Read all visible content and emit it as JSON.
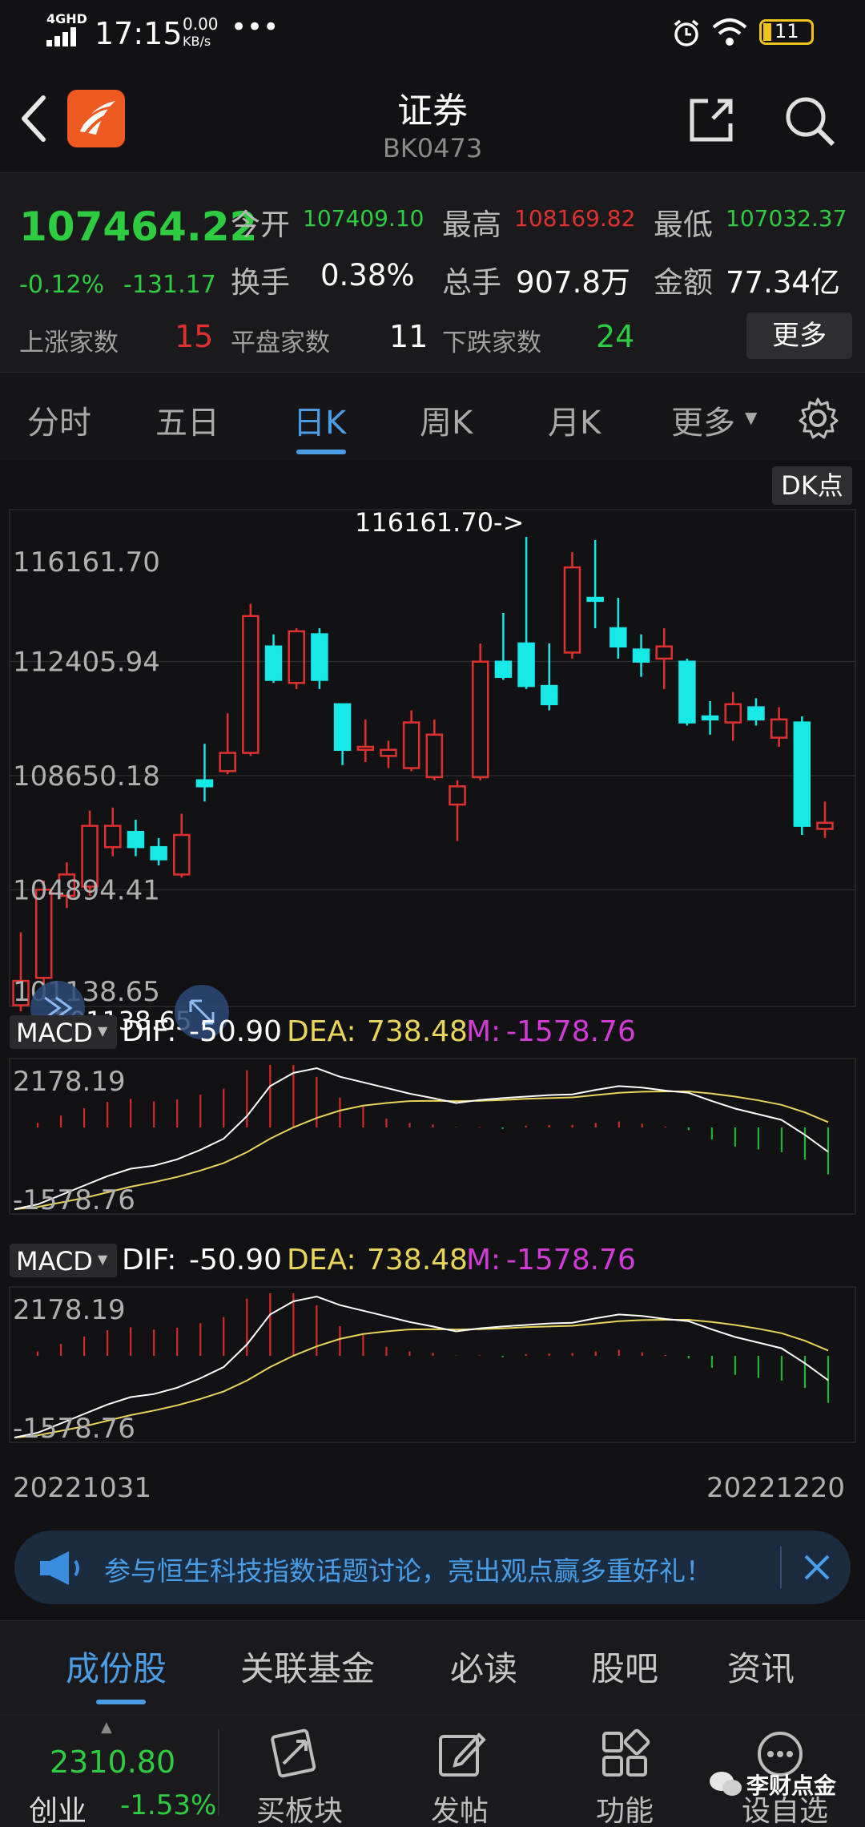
{
  "status_bar": {
    "network": "4GHD",
    "time": "17:15",
    "speed_value": "0.00",
    "speed_unit": "KB/s",
    "battery": "11"
  },
  "header": {
    "title": "证券",
    "code": "BK0473"
  },
  "quote": {
    "price": "107464.22",
    "change_pct": "-0.12%",
    "change_abs": "-131.17",
    "open_label": "今开",
    "open": "107409.10",
    "high_label": "最高",
    "high": "108169.82",
    "low_label": "最低",
    "low": "107032.37",
    "turnover_label": "换手",
    "turnover": "0.38%",
    "volume_label": "总手",
    "volume": "907.8万",
    "amount_label": "金额",
    "amount": "77.34亿",
    "up_label": "上涨家数",
    "up": "15",
    "flat_label": "平盘家数",
    "flat": "11",
    "down_label": "下跌家数",
    "down": "24",
    "more_button": "更多"
  },
  "tabs": [
    "分时",
    "五日",
    "日K",
    "周K",
    "月K",
    "更多"
  ],
  "active_tab": "日K",
  "chart_controls": {
    "dk_button": "DK点",
    "max_marker": "116161.70->",
    "min_marker": "<-101138.65"
  },
  "chart_data": {
    "type": "candlestick",
    "y_ticks": [
      "116161.70",
      "112405.94",
      "108650.18",
      "104894.41",
      "101138.65"
    ],
    "ylim": [
      101138.65,
      116161.7
    ],
    "x_start": "20221031",
    "x_end": "20221220",
    "colors": {
      "up": "#e0312f",
      "down": "#17e8e8"
    },
    "candles": [
      {
        "o": 101100,
        "c": 101900,
        "h": 103500,
        "l": 100900
      },
      {
        "o": 102000,
        "c": 104900,
        "h": 105200,
        "l": 101500
      },
      {
        "o": 104700,
        "c": 105400,
        "h": 105800,
        "l": 104300
      },
      {
        "o": 105000,
        "c": 107000,
        "h": 107500,
        "l": 104700
      },
      {
        "o": 106300,
        "c": 107000,
        "h": 107600,
        "l": 106000
      },
      {
        "o": 106800,
        "c": 106300,
        "h": 107200,
        "l": 106000
      },
      {
        "o": 106300,
        "c": 105900,
        "h": 106600,
        "l": 105700
      },
      {
        "o": 105400,
        "c": 106700,
        "h": 107400,
        "l": 105300
      },
      {
        "o": 108500,
        "c": 108300,
        "h": 109700,
        "l": 107800
      },
      {
        "o": 108800,
        "c": 109400,
        "h": 110700,
        "l": 108700
      },
      {
        "o": 109400,
        "c": 113900,
        "h": 114300,
        "l": 109300
      },
      {
        "o": 112900,
        "c": 111800,
        "h": 113300,
        "l": 111700
      },
      {
        "o": 111700,
        "c": 113400,
        "h": 113500,
        "l": 111500
      },
      {
        "o": 113300,
        "c": 111800,
        "h": 113500,
        "l": 111500
      },
      {
        "o": 111000,
        "c": 109500,
        "h": 111000,
        "l": 109000
      },
      {
        "o": 109500,
        "c": 109600,
        "h": 110500,
        "l": 109100
      },
      {
        "o": 109300,
        "c": 109500,
        "h": 109800,
        "l": 108900
      },
      {
        "o": 108900,
        "c": 110400,
        "h": 110800,
        "l": 108800
      },
      {
        "o": 108600,
        "c": 110000,
        "h": 110500,
        "l": 108500
      },
      {
        "o": 107700,
        "c": 108300,
        "h": 108500,
        "l": 106500
      },
      {
        "o": 108600,
        "c": 112400,
        "h": 113000,
        "l": 108500
      },
      {
        "o": 112400,
        "c": 111900,
        "h": 114000,
        "l": 111800
      },
      {
        "o": 113000,
        "c": 111600,
        "h": 116500,
        "l": 111500
      },
      {
        "o": 111600,
        "c": 111000,
        "h": 113000,
        "l": 110800
      },
      {
        "o": 112700,
        "c": 115500,
        "h": 116000,
        "l": 112500
      },
      {
        "o": 114500,
        "c": 114400,
        "h": 116400,
        "l": 113500
      },
      {
        "o": 113500,
        "c": 112900,
        "h": 114500,
        "l": 112500
      },
      {
        "o": 112800,
        "c": 112400,
        "h": 113300,
        "l": 111900
      },
      {
        "o": 112500,
        "c": 112900,
        "h": 113500,
        "l": 111500
      },
      {
        "o": 112400,
        "c": 110400,
        "h": 112500,
        "l": 110300
      },
      {
        "o": 110600,
        "c": 110500,
        "h": 111100,
        "l": 110000
      },
      {
        "o": 110400,
        "c": 111000,
        "h": 111400,
        "l": 109800
      },
      {
        "o": 110900,
        "c": 110500,
        "h": 111200,
        "l": 110300
      },
      {
        "o": 109900,
        "c": 110500,
        "h": 110900,
        "l": 109600
      },
      {
        "o": 110400,
        "c": 107000,
        "h": 110600,
        "l": 106700
      },
      {
        "o": 106900,
        "c": 107100,
        "h": 107800,
        "l": 106600
      }
    ],
    "macd_panels": [
      {
        "label": "MACD",
        "dif_label": "DIF:",
        "dif": "-50.90",
        "dea_label": "DEA:",
        "dea": "738.48",
        "m_label": "M:",
        "m": "-1578.76",
        "ymax_label": "2178.19",
        "ymin_label": "-1578.76",
        "ylim": [
          -1578.76,
          2178.19
        ],
        "dif_series": [
          -1578.76,
          -1450,
          -1200,
          -950,
          -700,
          -500,
          -420,
          -250,
          0,
          300,
          900,
          1700,
          2050,
          2178.19,
          1950,
          1800,
          1650,
          1500,
          1380,
          1250,
          1330,
          1380,
          1420,
          1460,
          1480,
          1600,
          1700,
          1660,
          1580,
          1520,
          1300,
          1100,
          950,
          800,
          400,
          -50.9
        ],
        "dea_series": [
          -1578.76,
          -1520,
          -1400,
          -1280,
          -1130,
          -980,
          -860,
          -720,
          -550,
          -350,
          -60,
          300,
          600,
          850,
          1050,
          1180,
          1250,
          1300,
          1310,
          1300,
          1310,
          1330,
          1360,
          1380,
          1400,
          1460,
          1520,
          1550,
          1560,
          1560,
          1500,
          1420,
          1320,
          1200,
          1000,
          738.48
        ],
        "hist_series": [
          2,
          150,
          400,
          650,
          860,
          960,
          880,
          940,
          1100,
          1300,
          1920,
          2100,
          2100,
          1700,
          1000,
          700,
          300,
          150,
          100,
          10,
          20,
          -50,
          60,
          80,
          90,
          150,
          200,
          120,
          30,
          -90,
          -400,
          -640,
          -740,
          -830,
          -1080,
          -1578.76
        ]
      },
      {
        "label": "MACD",
        "dif_label": "DIF:",
        "dif": "-50.90",
        "dea_label": "DEA:",
        "dea": "738.48",
        "m_label": "M:",
        "m": "-1578.76",
        "ymax_label": "2178.19",
        "ymin_label": "-1578.76",
        "ylim": [
          -1578.76,
          2178.19
        ],
        "dif_series": [
          -1578.76,
          -1450,
          -1200,
          -950,
          -700,
          -500,
          -420,
          -250,
          0,
          300,
          900,
          1700,
          2050,
          2178.19,
          1950,
          1800,
          1650,
          1500,
          1380,
          1250,
          1330,
          1380,
          1420,
          1460,
          1480,
          1600,
          1700,
          1660,
          1580,
          1520,
          1300,
          1100,
          950,
          800,
          400,
          -50.9
        ],
        "dea_series": [
          -1578.76,
          -1520,
          -1400,
          -1280,
          -1130,
          -980,
          -860,
          -720,
          -550,
          -350,
          -60,
          300,
          600,
          850,
          1050,
          1180,
          1250,
          1300,
          1310,
          1300,
          1310,
          1330,
          1360,
          1380,
          1400,
          1460,
          1520,
          1550,
          1560,
          1560,
          1500,
          1420,
          1320,
          1200,
          1000,
          738.48
        ],
        "hist_series": [
          2,
          150,
          400,
          650,
          860,
          960,
          880,
          940,
          1100,
          1300,
          1920,
          2100,
          2100,
          1700,
          1000,
          700,
          300,
          150,
          100,
          10,
          20,
          -50,
          60,
          80,
          90,
          150,
          200,
          120,
          30,
          -90,
          -400,
          -640,
          -740,
          -830,
          -1080,
          -1578.76
        ]
      }
    ]
  },
  "banner": {
    "text": "参与恒生科技指数话题讨论，亮出观点赢多重好礼！"
  },
  "sub_tabs": [
    "成份股",
    "关联基金",
    "必读",
    "股吧",
    "资讯"
  ],
  "active_sub_tab": "成份股",
  "bottom_bar": {
    "index_value": "2310.80",
    "index_name": "创业",
    "index_change": "-1.53%",
    "buttons": [
      "买板块",
      "发帖",
      "功能",
      "设自选"
    ],
    "watermark": "李财点金"
  }
}
